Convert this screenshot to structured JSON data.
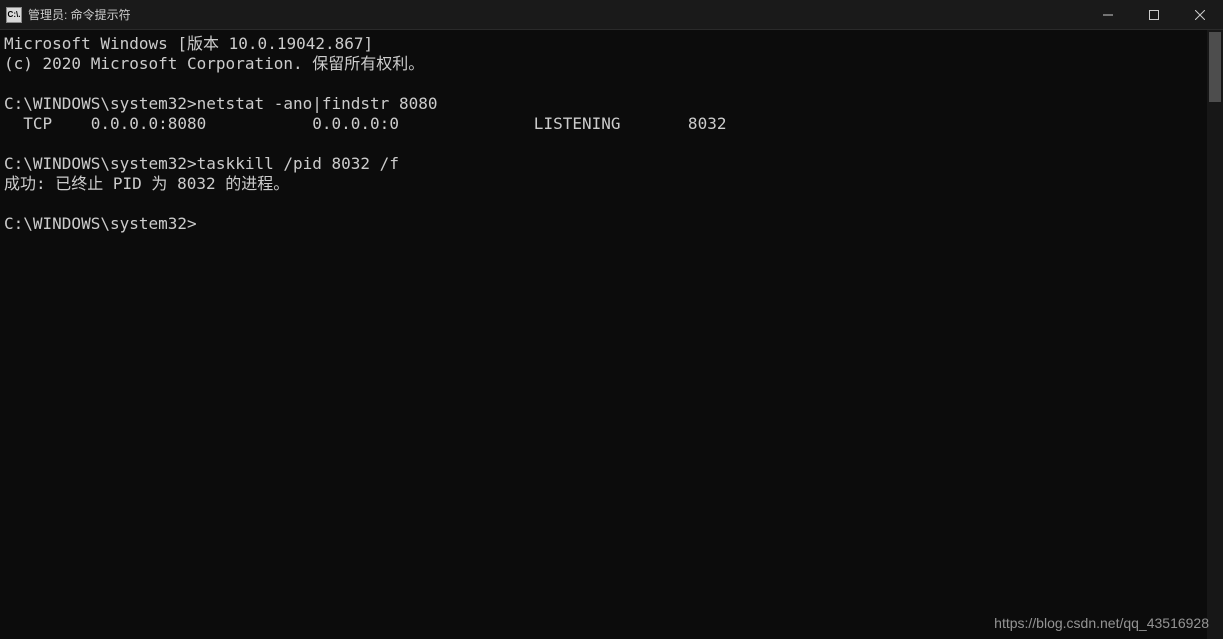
{
  "window": {
    "title": "管理员: 命令提示符",
    "icon_label": "C:\\."
  },
  "terminal": {
    "lines": [
      "Microsoft Windows [版本 10.0.19042.867]",
      "(c) 2020 Microsoft Corporation. 保留所有权利。",
      "",
      "C:\\WINDOWS\\system32>netstat -ano|findstr 8080",
      "  TCP    0.0.0.0:8080           0.0.0.0:0              LISTENING       8032",
      "",
      "C:\\WINDOWS\\system32>taskkill /pid 8032 /f",
      "成功: 已终止 PID 为 8032 的进程。",
      "",
      "C:\\WINDOWS\\system32>"
    ]
  },
  "watermark": "https://blog.csdn.net/qq_43516928"
}
